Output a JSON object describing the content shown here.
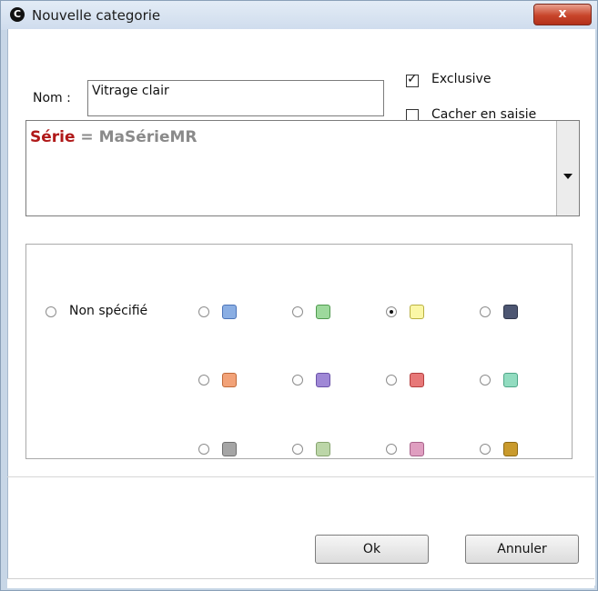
{
  "window": {
    "title": "Nouvelle categorie",
    "close_symbol": "x",
    "app_icon_glyph": "C"
  },
  "form": {
    "nom_label": "Nom :",
    "nom_value": "Vitrage clair",
    "exclusive_label": "Exclusive",
    "exclusive_checked": true,
    "cacher_label": "Cacher en saisie",
    "cacher_checked": false
  },
  "formula": {
    "key": "Série",
    "operator": " = ",
    "value": "MaSérieMR"
  },
  "colors": {
    "non_specifie_label": "Non spécifié",
    "selected": "yellow",
    "swatches": [
      {
        "name": "blue",
        "fill": "#8aaee3",
        "border": "#4c74b8"
      },
      {
        "name": "green",
        "fill": "#9dd99c",
        "border": "#4f9a4e"
      },
      {
        "name": "yellow",
        "fill": "#fbf7a6",
        "border": "#b8b042"
      },
      {
        "name": "dark-slate",
        "fill": "#4d5672",
        "border": "#2e354a"
      },
      {
        "name": "orange",
        "fill": "#f2a278",
        "border": "#c06a3a"
      },
      {
        "name": "purple",
        "fill": "#9f88d6",
        "border": "#6a52a8"
      },
      {
        "name": "red",
        "fill": "#e77878",
        "border": "#b33e3e"
      },
      {
        "name": "teal",
        "fill": "#92dcc0",
        "border": "#4fa688"
      },
      {
        "name": "gray",
        "fill": "#a5a5a5",
        "border": "#707070"
      },
      {
        "name": "sage",
        "fill": "#bcd6a8",
        "border": "#86a46e"
      },
      {
        "name": "pink",
        "fill": "#df9ec0",
        "border": "#a8628a"
      },
      {
        "name": "ochre",
        "fill": "#c99a2c",
        "border": "#8e6a13"
      }
    ]
  },
  "buttons": {
    "ok_label": "Ok",
    "cancel_label": "Annuler"
  }
}
